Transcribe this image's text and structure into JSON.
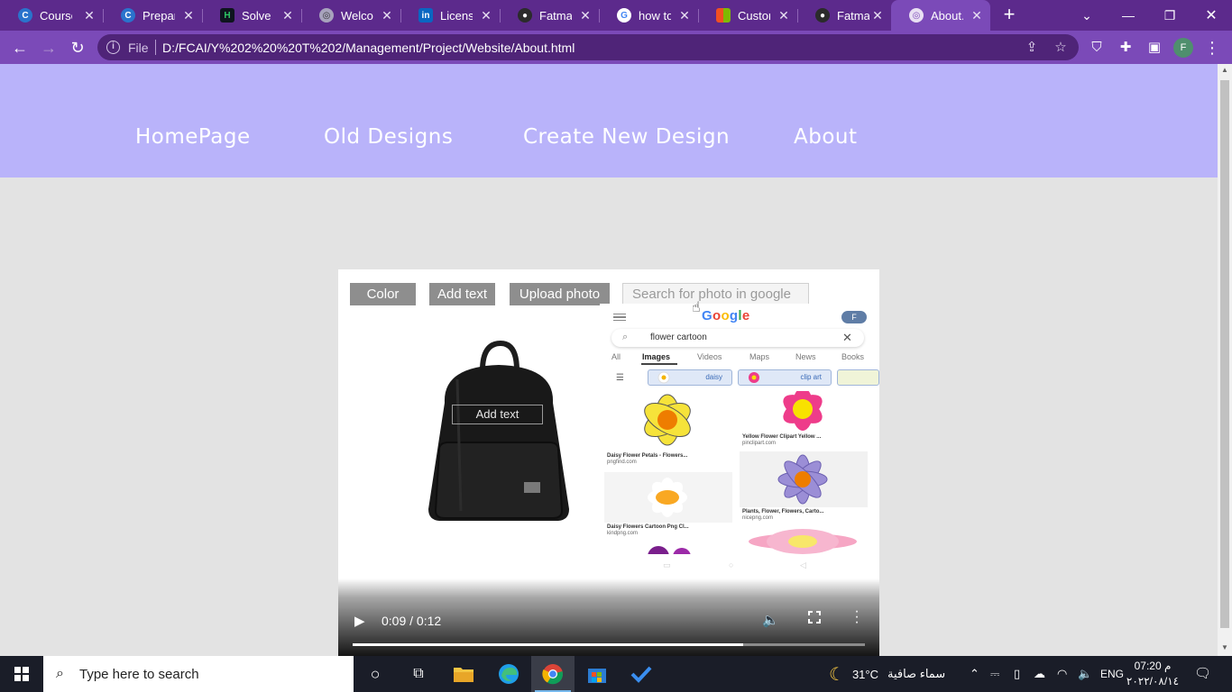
{
  "browser": {
    "tabs": [
      {
        "label": "Coursera",
        "favicon": "coursera-icon"
      },
      {
        "label": "Prepare",
        "favicon": "coursera-icon"
      },
      {
        "label": "Solve SQ",
        "favicon": "hackerrank-icon"
      },
      {
        "label": "Welcom",
        "favicon": "globe-icon"
      },
      {
        "label": "Licenses",
        "favicon": "linkedin-icon"
      },
      {
        "label": "FatmaK",
        "favicon": "github-icon"
      },
      {
        "label": "how to c",
        "favicon": "google-icon"
      },
      {
        "label": "Customi",
        "favicon": "microsoft-icon"
      },
      {
        "label": "FatmaK",
        "favicon": "github-icon"
      },
      {
        "label": "About.h",
        "favicon": "globe-icon"
      }
    ],
    "address": {
      "scheme_label": "File",
      "url": "D:/FCAI/Y%202%20%20T%202/Management/Project/Website/About.html"
    },
    "profile_initial": "F",
    "accent": "#7b4ab8"
  },
  "site": {
    "nav": [
      "HomePage",
      "Old Designs",
      "Create New Design",
      "About"
    ],
    "nav_bg": "#b9b3fa"
  },
  "video": {
    "buttons": [
      "Color",
      "Add text",
      "Upload photo"
    ],
    "search_placeholder": "Search for photo in google",
    "bag_label": "Add text",
    "google": {
      "logo": "Google",
      "avatar": "F",
      "query": "flower cartoon",
      "tabs": [
        "All",
        "Images",
        "Videos",
        "Maps",
        "News",
        "Books"
      ],
      "chips": [
        "daisy",
        "clip art"
      ],
      "results": [
        {
          "caption": "Daisy Flower Petals - Flowers...",
          "source": "pngfind.com"
        },
        {
          "caption": "Yellow Flower Clipart Yellow ...",
          "source": "pinclipart.com"
        },
        {
          "caption": "Daisy Flowers Cartoon Png Cl...",
          "source": "kindpng.com"
        },
        {
          "caption": "Plants, Flower, Flowers, Carto...",
          "source": "nicepng.com"
        }
      ]
    },
    "time": "0:09 / 0:12",
    "progress_fraction": 0.7627
  },
  "taskbar": {
    "search_placeholder": "Type here to search",
    "weather_temp": "31°C",
    "weather_desc": "سماء صافية",
    "language": "ENG",
    "time": "07:20 م",
    "date": "٢٠٢٢/٠٨/١٤"
  }
}
